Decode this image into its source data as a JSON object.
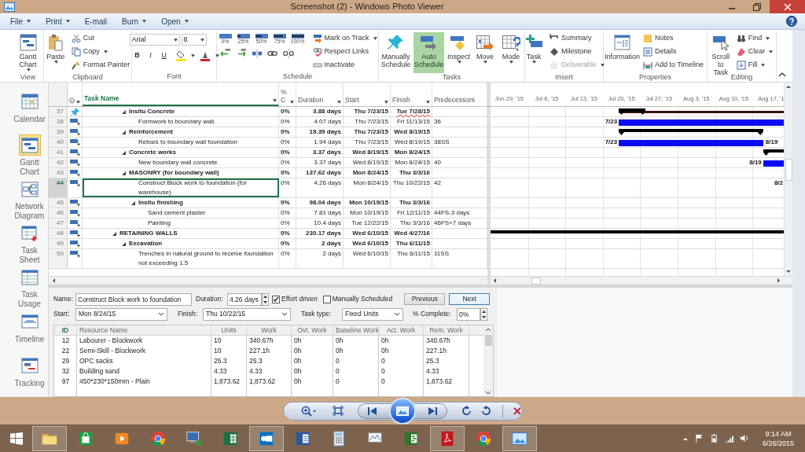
{
  "window": {
    "title": "Screenshot (2) - Windows Photo Viewer"
  },
  "menu": [
    {
      "label": "File",
      "dropdown": true
    },
    {
      "label": "Print",
      "dropdown": true
    },
    {
      "label": "E-mail",
      "dropdown": false
    },
    {
      "label": "Burn",
      "dropdown": true
    },
    {
      "label": "Open",
      "dropdown": true
    }
  ],
  "ribbon": {
    "groups": [
      {
        "label": "View",
        "items": [
          {
            "kind": "large",
            "label": "Gantt Chart",
            "dropdown": true
          }
        ]
      },
      {
        "label": "Clipboard",
        "items": [
          {
            "kind": "large",
            "label": "Paste",
            "dropdown": true
          },
          {
            "kind": "small",
            "label": "Cut",
            "dropdown": false
          },
          {
            "kind": "small",
            "label": "Copy",
            "dropdown": true
          },
          {
            "kind": "small",
            "label": "Format Painter",
            "dropdown": false
          }
        ]
      },
      {
        "label": "Font",
        "items": [
          {
            "kind": "font",
            "font_name": "Arial",
            "font_size": "8",
            "styles": [
              "B",
              "I",
              "U"
            ]
          }
        ]
      },
      {
        "label": "Schedule",
        "items": [
          {
            "kind": "progress",
            "labels": [
              "0%",
              "25%",
              "50%",
              "75%",
              "100%"
            ]
          },
          {
            "kind": "small",
            "label": "Mark on Track",
            "dropdown": true
          },
          {
            "kind": "small",
            "label": "Respect Links",
            "dropdown": false
          },
          {
            "kind": "small",
            "label": "Inactivate",
            "dropdown": false
          }
        ]
      },
      {
        "label": "Tasks",
        "items": [
          {
            "kind": "large",
            "label": "Manually Schedule",
            "dropdown": false,
            "selected": false
          },
          {
            "kind": "large",
            "label": "Auto Schedule",
            "dropdown": false,
            "selected": true
          },
          {
            "kind": "large",
            "label": "Inspect",
            "dropdown": true,
            "selected": false
          },
          {
            "kind": "large",
            "label": "Move",
            "dropdown": true,
            "selected": false
          },
          {
            "kind": "large",
            "label": "Mode",
            "dropdown": true,
            "selected": false
          }
        ]
      },
      {
        "label": "Insert",
        "items": [
          {
            "kind": "large",
            "label": "Task",
            "dropdown": true,
            "disabled": false
          },
          {
            "kind": "small",
            "label": "Summary",
            "dropdown": false,
            "disabled": false
          },
          {
            "kind": "small",
            "label": "Milestone",
            "dropdown": false,
            "disabled": false
          },
          {
            "kind": "small",
            "label": "Deliverable",
            "dropdown": true,
            "disabled": true
          }
        ]
      },
      {
        "label": "Properties",
        "items": [
          {
            "kind": "large",
            "label": "Information",
            "dropdown": false
          },
          {
            "kind": "small",
            "label": "Notes",
            "dropdown": false
          },
          {
            "kind": "small",
            "label": "Details",
            "dropdown": false
          },
          {
            "kind": "small",
            "label": "Add to Timeline",
            "dropdown": false
          }
        ]
      },
      {
        "label": "Editing",
        "items": [
          {
            "kind": "large",
            "label": "Scroll to Task",
            "dropdown": false
          },
          {
            "kind": "small",
            "label": "Find",
            "dropdown": true
          },
          {
            "kind": "small",
            "label": "Clear",
            "dropdown": true
          },
          {
            "kind": "small",
            "label": "Fill",
            "dropdown": true
          }
        ]
      }
    ]
  },
  "views": [
    {
      "label": "Calendar",
      "selected": false
    },
    {
      "label": "Gantt Chart",
      "selected": true
    },
    {
      "label": "Network Diagram",
      "selected": false
    },
    {
      "label": "Task Sheet",
      "selected": false
    },
    {
      "label": "Task Usage",
      "selected": false
    },
    {
      "label": "Timeline",
      "selected": false
    },
    {
      "label": "Tracking",
      "selected": false
    }
  ],
  "table": {
    "columns": [
      {
        "kind": "indicators",
        "filter": true
      },
      {
        "kind": "name",
        "label": "Task Name",
        "filter": true
      },
      {
        "kind": "complete",
        "label": "% C",
        "filter": true
      },
      {
        "kind": "duration",
        "label": "Duration",
        "filter": true
      },
      {
        "kind": "start",
        "label": "Start",
        "filter": true
      },
      {
        "kind": "finish",
        "label": "Finish",
        "filter": true
      },
      {
        "kind": "predecessors",
        "label": "Predecessors",
        "filter": false
      }
    ],
    "rows": [
      {
        "kind": "subphase",
        "id": "37",
        "manually_scheduled": true,
        "name": "Insitu Concrete",
        "complete": "0%",
        "duration": "3.88 days",
        "start": "Thu 7/23/15",
        "finish": "Tue 7/28/15",
        "finish_flagged": true,
        "selected": false,
        "children": [
          {
            "id": "38",
            "manually_scheduled": false,
            "name": "Formwork to boundary wall.",
            "complete": "0%",
            "duration": "4.07 days",
            "start": "Thu 7/23/15",
            "finish": "Fri 11/13/15",
            "predecessors": "36",
            "finish_flagged": false,
            "selected": false,
            "bar_labels": {
              "left": "7/23"
            }
          }
        ]
      },
      {
        "kind": "subphase",
        "id": "39",
        "manually_scheduled": false,
        "name": "Reinforcement",
        "complete": "0%",
        "duration": "19.39 days",
        "start": "Thu 7/23/15",
        "finish": "Wed 8/19/15",
        "finish_flagged": false,
        "selected": false,
        "children": [
          {
            "id": "40",
            "manually_scheduled": false,
            "name": "Rebars to boundary wall foundation",
            "complete": "0%",
            "duration": "1.94 days",
            "start": "Thu 7/23/15",
            "finish": "Wed 8/19/15",
            "predecessors": "38SS",
            "finish_flagged": false,
            "selected": false,
            "bar_labels": {
              "left": "7/23",
              "right": "8/19"
            }
          }
        ]
      },
      {
        "kind": "subphase",
        "id": "41",
        "manually_scheduled": false,
        "name": "Concrete works",
        "complete": "0%",
        "duration": "3.37 days",
        "start": "Wed 8/19/15",
        "finish": "Mon 8/24/15",
        "finish_flagged": false,
        "selected": false,
        "children": [
          {
            "id": "42",
            "manually_scheduled": false,
            "name": "New boundary wall concrete",
            "complete": "0%",
            "duration": "3.37 days",
            "start": "Wed 8/19/15",
            "finish": "Mon 8/24/15",
            "predecessors": "40",
            "finish_flagged": false,
            "selected": false,
            "bar_labels": {
              "left": "8/19"
            }
          }
        ]
      },
      {
        "kind": "subphase",
        "id": "43",
        "manually_scheduled": false,
        "name": "MASONRY (for boundary wall)",
        "complete": "0%",
        "duration": "137.62 days",
        "start": "Mon 8/24/15",
        "finish": "Thu 3/3/16",
        "finish_flagged": false,
        "selected": false,
        "children": [
          {
            "id": "44",
            "manually_scheduled": false,
            "name": "Construct Block work to foundation (for warehouse)",
            "complete": "0%",
            "duration": "4.26 days",
            "start": "Mon 8/24/15",
            "finish": "Thu 10/22/15",
            "predecessors": "42",
            "finish_flagged": false,
            "selected": true,
            "bar_labels": {
              "left": "8/2"
            }
          },
          {
            "id": "45",
            "manually_scheduled": false,
            "name": "Insitu finishing",
            "complete": "0%",
            "duration": "98.04 days",
            "start": "Mon 10/19/15",
            "finish": "Thu 3/3/16",
            "finish_flagged": false,
            "selected": false,
            "children": [
              {
                "id": "46",
                "manually_scheduled": false,
                "name": "Sand cement plaster",
                "complete": "0%",
                "duration": "7.81 days",
                "start": "Mon 10/19/15",
                "finish": "Fri 12/11/15",
                "predecessors": "44FS-3 days",
                "finish_flagged": false,
                "selected": false
              },
              {
                "id": "47",
                "manually_scheduled": false,
                "name": "Painting",
                "complete": "0%",
                "duration": "10.4 days",
                "start": "Tue 12/22/15",
                "finish": "Thu 3/3/16",
                "predecessors": "46FS+7 days",
                "finish_flagged": false,
                "selected": false
              }
            ]
          }
        ]
      },
      {
        "kind": "phase",
        "id": "48",
        "manually_scheduled": false,
        "name": "RETAINING WALLS",
        "complete": "0%",
        "duration": "230.17 days",
        "start": "Wed 6/10/15",
        "finish": "Wed 4/27/16",
        "finish_flagged": false,
        "selected": false,
        "children": [
          {
            "id": "49",
            "manually_scheduled": false,
            "name": "Excavation",
            "complete": "0%",
            "duration": "2 days",
            "start": "Wed 6/10/15",
            "finish": "Thu 6/11/15",
            "finish_flagged": false,
            "selected": false,
            "children": [
              {
                "id": "50",
                "manually_scheduled": false,
                "name": "Trenches in natural ground to receive foundation not exceeding 1.5",
                "complete": "0%",
                "duration": "2 days",
                "start": "Wed 6/10/15",
                "finish": "Thu 6/11/15",
                "predecessors": "11SS",
                "finish_flagged": false,
                "selected": false
              }
            ]
          }
        ]
      }
    ]
  },
  "gantt": {
    "timescale": [
      "Jun 29, '15",
      "Jul 6, '15",
      "Jul 13, '15",
      "Jul 20, '15",
      "Jul 27, '15",
      "Aug 3, '15",
      "Aug 10, '15",
      "Aug 17, '1"
    ]
  },
  "task_form": {
    "name": {
      "label": "Name:",
      "value": "Construct Block work to foundation"
    },
    "duration": {
      "label": "Duration:",
      "value": "4.26 days"
    },
    "effort_driven": {
      "label": "Effort driven",
      "checked": true
    },
    "manually_scheduled": {
      "label": "Manually Scheduled",
      "checked": false
    },
    "buttons": [
      {
        "label": "Previous",
        "default": false
      },
      {
        "label": "Next",
        "default": true
      }
    ],
    "start": {
      "label": "Start:",
      "value": "Mon 8/24/15"
    },
    "finish": {
      "label": "Finish:",
      "value": "Thu 10/22/15"
    },
    "task_type": {
      "label": "Task type:",
      "value": "Fixed Units"
    },
    "percent_complete": {
      "label": "% Complete:",
      "value": "0%"
    },
    "resources": {
      "columns": [
        "ID",
        "Resource Name",
        "Units",
        "Work",
        "Ovt. Work",
        "Baseline Work",
        "Act. Work",
        "Rem. Work"
      ],
      "rows": [
        [
          "12",
          "Labourer - Blockwork",
          "10",
          "340.67h",
          "0h",
          "0h",
          "0h",
          "340.67h"
        ],
        [
          "22",
          "Semi-Skill - Blockwork",
          "10",
          "227.1h",
          "0h",
          "0h",
          "0h",
          "227.1h"
        ],
        [
          "29",
          "OPC sacks",
          "25.3",
          "25.3",
          "0h",
          "0",
          "0",
          "25.3"
        ],
        [
          "32",
          "Building sand",
          "4.33",
          "4.33",
          "0h",
          "0",
          "0",
          "4.33"
        ],
        [
          "97",
          "450*230*150mm - Plain",
          "1,873.62",
          "1,873.62",
          "0h",
          "0",
          "0",
          "1,873.62"
        ]
      ]
    }
  },
  "taskbar": {
    "apps": [
      {
        "open": true
      },
      {
        "open": false
      },
      {
        "open": false
      },
      {
        "open": false
      },
      {
        "open": false
      },
      {
        "open": false
      },
      {
        "open": true
      },
      {
        "open": false
      },
      {
        "open": false
      },
      {
        "open": false
      },
      {
        "open": false
      },
      {
        "open": true
      },
      {
        "open": false
      },
      {
        "open": true
      }
    ],
    "clock": {
      "time": "9:14 AM",
      "date": "6/26/2015"
    }
  }
}
